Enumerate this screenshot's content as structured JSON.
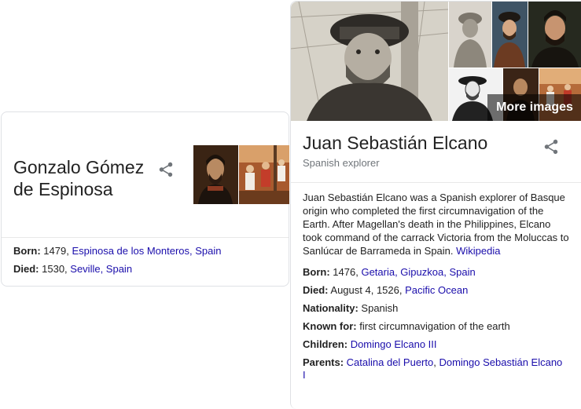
{
  "left_card": {
    "title": "Gonzalo Gómez de Espinosa",
    "born": {
      "label": "Born:",
      "year": "1479, ",
      "place": "Espinosa de los Monteros, Spain"
    },
    "died": {
      "label": "Died:",
      "year": "1530, ",
      "place": "Seville, Spain"
    }
  },
  "right_card": {
    "more_images": "More images",
    "title": "Juan Sebastián Elcano",
    "subtitle": "Spanish explorer",
    "description": "Juan Sebastián Elcano was a Spanish explorer of Basque origin who completed the first circumnavigation of the Earth. After Magellan's death in the Philippines, Elcano took command of the carrack Victoria from the Moluccas to Sanlúcar de Barrameda in Spain.",
    "source": "Wikipedia",
    "facts": {
      "born_label": "Born:",
      "born_text": "1476, ",
      "born_place": "Getaria, Gipuzkoa, Spain",
      "died_label": "Died:",
      "died_text": "August 4, 1526, ",
      "died_place": "Pacific Ocean",
      "nationality_label": "Nationality:",
      "nationality_text": "Spanish",
      "known_label": "Known for:",
      "known_text": "first circumnavigation of the earth",
      "children_label": "Children:",
      "children_link": "Domingo Elcano III",
      "parents_label": "Parents:",
      "parents_link1": "Catalina del Puerto",
      "parents_sep": ", ",
      "parents_link2": "Domingo Sebastián Elcano",
      "parents_line2": "I"
    }
  },
  "colors": {
    "link": "#1a0dab",
    "subtitle": "#70757a",
    "border": "#dfe1e5"
  },
  "icons": [
    "share-icon"
  ]
}
